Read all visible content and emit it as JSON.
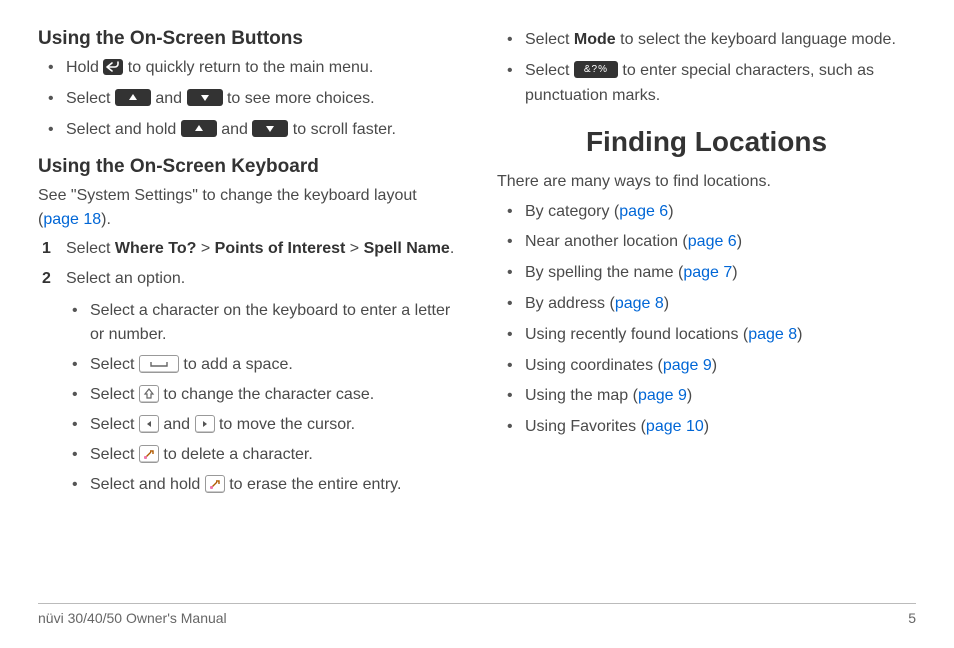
{
  "left": {
    "h_buttons": "Using the On-Screen Buttons",
    "buttons_list": {
      "i1a": "Hold ",
      "i1b": " to quickly return to the main menu.",
      "i2a": "Select ",
      "i2b": " and ",
      "i2c": " to see more choices.",
      "i3a": "Select and hold ",
      "i3b": " and ",
      "i3c": " to scroll faster."
    },
    "h_keyboard": "Using the On-Screen Keyboard",
    "kb_intro_a": "See \"System Settings\" to change the keyboard layout (",
    "kb_intro_link": "page 18",
    "kb_intro_b": ").",
    "step1_a": "Select ",
    "step1_b": "Where To?",
    "step1_c": " > ",
    "step1_d": "Points of Interest",
    "step1_e": " > ",
    "step1_f": "Spell Name",
    "step1_g": ".",
    "step2": "Select an option.",
    "sub": {
      "s1": "Select a character on the keyboard to enter a letter or number.",
      "s2a": "Select ",
      "s2b": " to add a space.",
      "s3a": "Select ",
      "s3b": " to change the character case.",
      "s4a": "Select ",
      "s4b": " and ",
      "s4c": " to move the cursor.",
      "s5a": "Select ",
      "s5b": " to delete a character.",
      "s6a": "Select and hold ",
      "s6b": " to erase the entire entry."
    }
  },
  "right": {
    "top": {
      "i1a": "Select ",
      "i1b": "Mode",
      "i1c": " to select the keyboard language mode.",
      "i2a": "Select ",
      "i2b": " to enter special characters, such as punctuation marks."
    },
    "h_finding": "Finding Locations",
    "intro": "There are many ways to find locations.",
    "list": [
      {
        "t": "By category (",
        "l": "page 6",
        "e": ")"
      },
      {
        "t": "Near another location (",
        "l": "page 6",
        "e": ")"
      },
      {
        "t": "By spelling the name (",
        "l": "page 7",
        "e": ")"
      },
      {
        "t": "By address (",
        "l": "page 8",
        "e": ")"
      },
      {
        "t": "Using recently found locations (",
        "l": "page 8",
        "e": ")"
      },
      {
        "t": "Using coordinates (",
        "l": "page 9",
        "e": ")"
      },
      {
        "t": "Using the map (",
        "l": "page 9",
        "e": ")"
      },
      {
        "t": "Using Favorites (",
        "l": "page 10",
        "e": ")"
      }
    ]
  },
  "footer": {
    "left": "nüvi 30/40/50 Owner's Manual",
    "right": "5"
  },
  "special_chars_label": "&?%"
}
